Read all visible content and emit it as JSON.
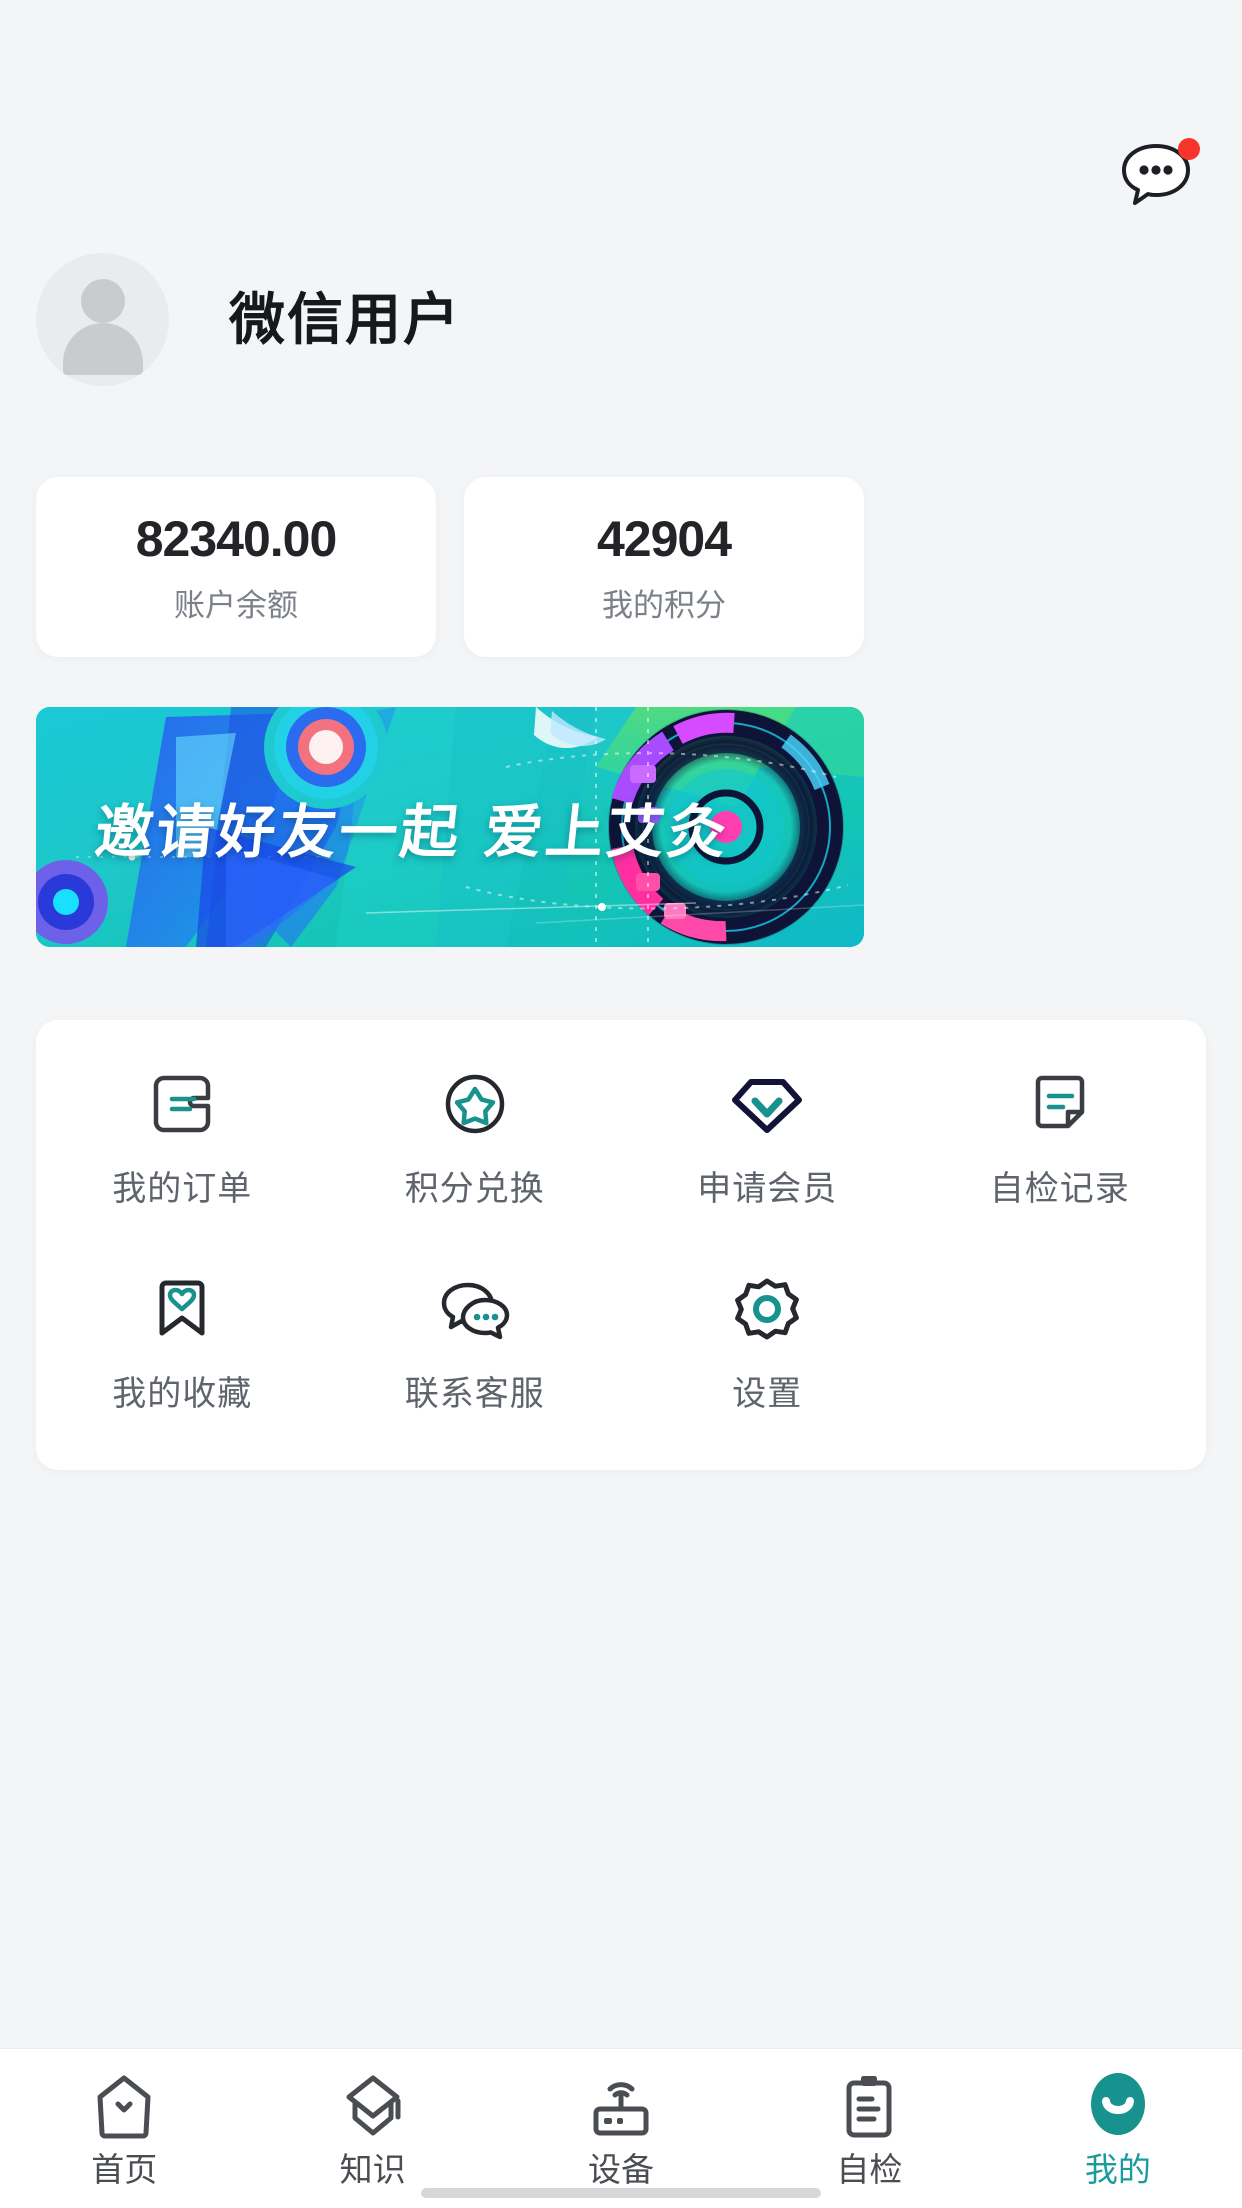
{
  "colors": {
    "page_background": "#f4f5f7",
    "card_background": "#ffffff",
    "accent_teal": "#1a9c9c",
    "icon_dark": "#3a3d42",
    "badge_red": "#f9342a",
    "banner_cyan": "#17c3cf",
    "muted_text": "#7c8089"
  },
  "header": {
    "chat_icon": "chat-bubble-icon",
    "has_unread_badge": true
  },
  "profile": {
    "avatar_icon": "default-user-avatar-icon",
    "username": "微信用户"
  },
  "stats": [
    {
      "value": "82340.00",
      "label": "账户余额",
      "name": "account-balance"
    },
    {
      "value": "42904",
      "label": "我的积分",
      "name": "my-points"
    }
  ],
  "banner": {
    "text": "邀请好友一起 爱上艾灸",
    "name": "invite-friends-banner"
  },
  "grid": {
    "items": [
      {
        "label": "我的订单",
        "icon": "order-list-icon"
      },
      {
        "label": "积分兑换",
        "icon": "star-circle-icon"
      },
      {
        "label": "申请会员",
        "icon": "diamond-membership-icon"
      },
      {
        "label": "自检记录",
        "icon": "document-note-icon"
      },
      {
        "label": "我的收藏",
        "icon": "bookmark-heart-icon"
      },
      {
        "label": "联系客服",
        "icon": "chat-support-icon"
      },
      {
        "label": "设置",
        "icon": "gear-icon"
      }
    ]
  },
  "tabbar": {
    "items": [
      {
        "label": "首页",
        "icon": "home-icon",
        "active": false
      },
      {
        "label": "知识",
        "icon": "graduation-cap-icon",
        "active": false
      },
      {
        "label": "设备",
        "icon": "router-device-icon",
        "active": false
      },
      {
        "label": "自检",
        "icon": "clipboard-icon",
        "active": false
      },
      {
        "label": "我的",
        "icon": "profile-smile-icon",
        "active": true
      }
    ]
  }
}
